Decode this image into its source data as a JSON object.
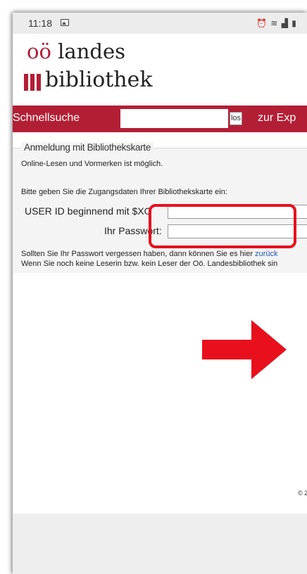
{
  "statusbar": {
    "time": "11:18",
    "icons": [
      "gallery-icon",
      "alarm-icon",
      "wifi-icon",
      "signal-icon",
      "battery-icon"
    ]
  },
  "logo": {
    "line1_oo": "oö",
    "line1_rest": "landes",
    "line2": "bibliothek",
    "brand_color": "#b11e36"
  },
  "searchbar": {
    "label": "Schnellsuche",
    "input_value": "",
    "go_label": "los",
    "expert_link": "zur Exp",
    "background": "#b21f35"
  },
  "login": {
    "legend": "Anmeldung mit Bibliothekskarte",
    "intro": "Online-Lesen und Vormerken ist möglich.",
    "instruction": "Bitte geben Sie die Zugangsdaten Ihrer Bibliothekskarte ein:",
    "userid_label": "USER ID beginnend mit $XO",
    "userid_value": "",
    "password_label": "Ihr Passwort:",
    "password_value": "",
    "forgot_text": "Sollten Sie Ihr Passwort vergessen haben, dann können Sie es hier",
    "forgot_link": "zurück",
    "register_text": "Wenn Sie noch keine Leserin bzw. kein Leser der Oö. Landesbibliothek sin"
  },
  "annotations": {
    "highlight_color": "#e8101c",
    "arrow_color": "#e8101c"
  },
  "footer": {
    "copyright": "© 2"
  }
}
